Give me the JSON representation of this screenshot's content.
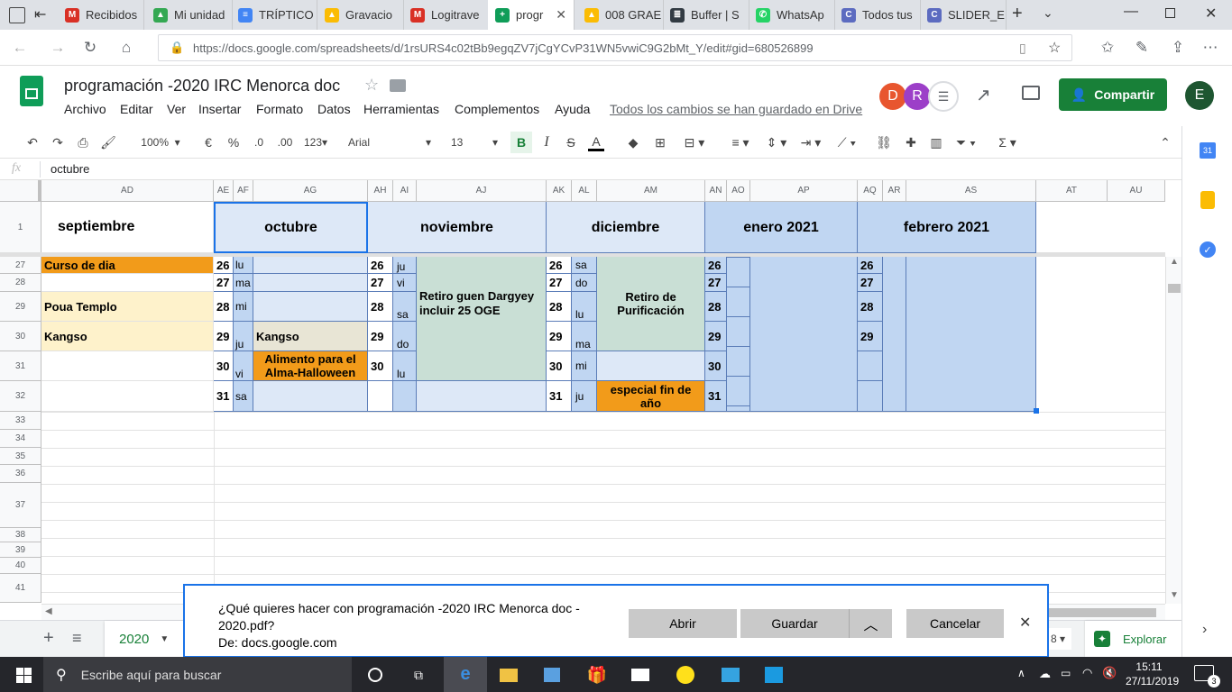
{
  "browser": {
    "tabs": [
      {
        "label": "Recibidos",
        "color": "#d93025",
        "glyph": "M"
      },
      {
        "label": "Mi unidad",
        "color": "#34a853",
        "glyph": "▲"
      },
      {
        "label": "TRÍPTICO",
        "color": "#4285f4",
        "glyph": "≡"
      },
      {
        "label": "Gravacio",
        "color": "#fbbc04",
        "glyph": "▲"
      },
      {
        "label": "Logitrave",
        "color": "#d93025",
        "glyph": "M"
      },
      {
        "label": "progr",
        "color": "#0f9d58",
        "glyph": "+"
      },
      {
        "label": "008 GRAE",
        "color": "#fbbc04",
        "glyph": "▲"
      },
      {
        "label": "Buffer | S",
        "color": "#323b43",
        "glyph": "≣"
      },
      {
        "label": "WhatsAp",
        "color": "#25d366",
        "glyph": "✆"
      },
      {
        "label": "Todos tus",
        "color": "#5c6bc0",
        "glyph": "C"
      },
      {
        "label": "SLIDER_E",
        "color": "#5c6bc0",
        "glyph": "C"
      }
    ],
    "url": "https://docs.google.com/spreadsheets/d/1rsURS4c02tBb9egqZV7jCgYCvP31WN5vwiC9G2bMt_Y/edit#gid=680526899"
  },
  "doc": {
    "title": "programación -2020 IRC Menorca doc",
    "menu": [
      "Archivo",
      "Editar",
      "Ver",
      "Insertar",
      "Formato",
      "Datos",
      "Herramientas",
      "Complementos",
      "Ayuda"
    ],
    "save_status": "Todos los cambios se han guardado en Drive",
    "share_label": "Compartir",
    "avatar_d": "D",
    "avatar_r": "R",
    "avatar_e": "E"
  },
  "toolbar": {
    "zoom": "100%",
    "currency": "€",
    "percent": "%",
    "dec_less": ".0",
    "dec_more": ".00",
    "format_more": "123",
    "font": "Arial",
    "font_size": "13",
    "bold": "B",
    "italic": "I",
    "strike": "S",
    "text_color": "A",
    "sum": "Σ"
  },
  "formula": {
    "fx": "fx",
    "value": "octubre"
  },
  "columns": [
    "AD",
    "AE",
    "AF",
    "AG",
    "AH",
    "AI",
    "AJ",
    "AK",
    "AL",
    "AM",
    "AN",
    "AO",
    "AP",
    "AQ",
    "AR",
    "AS",
    "AT",
    "AU"
  ],
  "rows": [
    "1",
    "27",
    "28",
    "29",
    "30",
    "31",
    "32",
    "33",
    "34",
    "35",
    "36",
    "37",
    "38",
    "39",
    "40",
    "41"
  ],
  "months": {
    "septiembre": "septiembre",
    "octubre": "octubre",
    "noviembre": "noviembre",
    "diciembre": "diciembre",
    "enero": "enero 2021",
    "febrero": "febrero 2021"
  },
  "cells": {
    "ad27": "Curso de dia",
    "ad29": "Poua Templo",
    "ad30": "Kangso",
    "oct_days": [
      "26",
      "27",
      "28",
      "29",
      "30",
      "31"
    ],
    "oct_wd": [
      "lu",
      "ma",
      "mi",
      "ju",
      "vi",
      "sa"
    ],
    "ag30": "Kangso",
    "ag31": "Alimento para el Alma-Halloween",
    "nov_days": [
      "26",
      "27",
      "28",
      "29",
      "30"
    ],
    "nov_wd": [
      "ju",
      "vi",
      "sa",
      "do",
      "lu"
    ],
    "aj_event": "Retiro guen Dargyey incluir 25 OGE",
    "dic_days": [
      "26",
      "27",
      "28",
      "29",
      "30",
      "31"
    ],
    "dic_wd": [
      "sa",
      "do",
      "lu",
      "ma",
      "mi",
      "ju"
    ],
    "am_event": "Retiro de Purificación",
    "am32": "especial fin de año",
    "ene_days": [
      "26",
      "27",
      "28",
      "29",
      "30",
      "31"
    ],
    "feb_days": [
      "26",
      "27",
      "28",
      "29"
    ]
  },
  "sheet": {
    "tab_label": "2020",
    "explore_label": "Explorar"
  },
  "download": {
    "question": "¿Qué quieres hacer con programación -2020 IRC Menorca doc - 2020.pdf?",
    "from": "De: docs.google.com",
    "open": "Abrir",
    "save": "Guardar",
    "cancel": "Cancelar"
  },
  "taskbar": {
    "search_placeholder": "Escribe aquí para buscar",
    "time": "15:11",
    "date": "27/11/2019",
    "notif_count": "3"
  },
  "colors": {
    "orange": "#f29b1a",
    "light_yellow": "#fef2cb",
    "beige": "#e8e5d5",
    "light_blue": "#dde8f7",
    "mid_blue": "#c0d6f2",
    "green_gray": "#c9dfd5",
    "share_green": "#188038"
  }
}
